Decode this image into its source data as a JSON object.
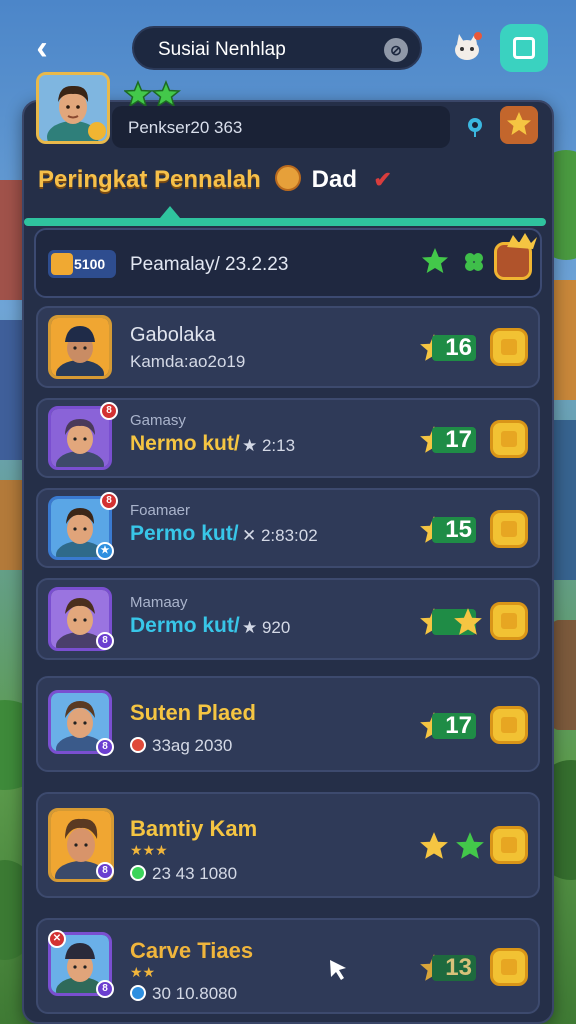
{
  "header": {
    "back_label": "‹",
    "search_text": "Susiai Nenhlap",
    "search_icon": "search-icon",
    "pet_icon": "cat-icon",
    "menu_icon": "menu-icon"
  },
  "profile": {
    "name": "Penkser20 363",
    "stars": 2,
    "pin_icon": "location-pin-icon",
    "badge_icon": "star-badge-icon"
  },
  "title": {
    "text": "Peringkat Pennalah",
    "dad": "Dad",
    "check": "✔"
  },
  "me_row": {
    "rank": "5100",
    "text": "Peamalay/ 23.2.23"
  },
  "rows": [
    {
      "small": "",
      "name": "Gabolaka",
      "sub": "Kamda:ao2o19",
      "sub_style": "grey-plain",
      "score": "16"
    },
    {
      "small": "Gamasy",
      "name": "Nermo kut/",
      "sub_extra": "★ 2:13",
      "score": "17"
    },
    {
      "small": "Foamaer",
      "name": "Permo kut/",
      "sub_extra": "✕ 2:83:02",
      "score": "15"
    },
    {
      "small": "Mamaay",
      "name": "Dermo kut/",
      "sub_extra": "★ 920",
      "score": ""
    },
    {
      "name": "Suten Plaed",
      "sub": "33ag 2030",
      "score": "17"
    },
    {
      "name": "Bamtiy Kam",
      "stars_text": "★★★",
      "sub": "23 43 1080",
      "score": ""
    },
    {
      "name": "Carve Tiaes",
      "stars_text": "★★",
      "sub": "30 10.8080",
      "score": "13"
    }
  ],
  "colors": {
    "gold": "#f5c542",
    "cyan": "#38c6e8",
    "green": "#2fc39e",
    "panel": "#252f48"
  }
}
